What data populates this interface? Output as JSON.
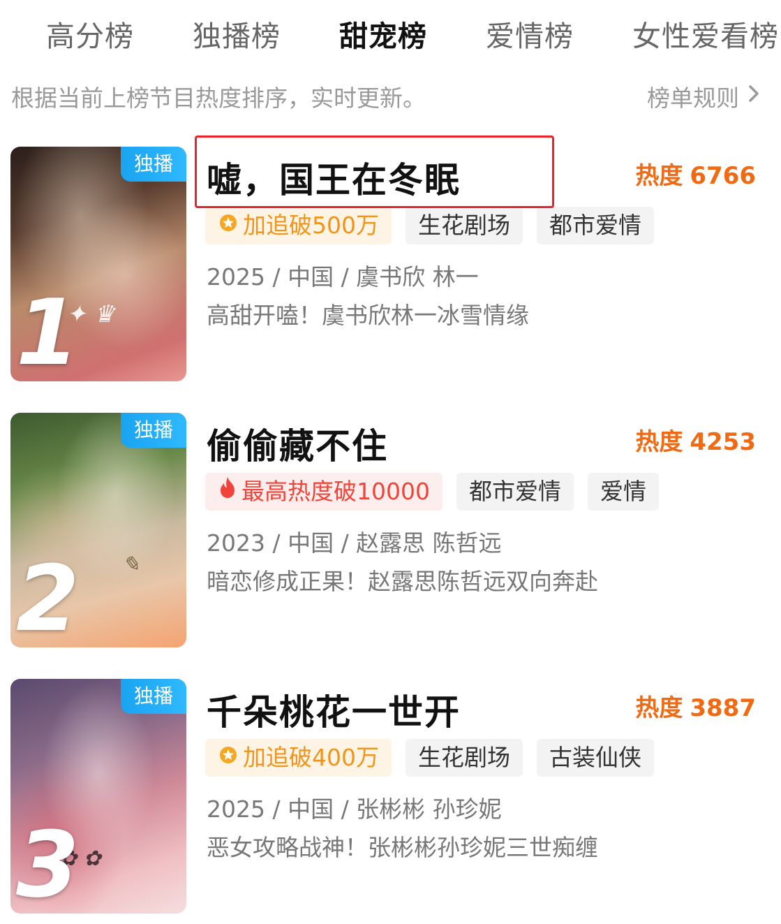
{
  "tabs": [
    "高分榜",
    "独播榜",
    "甜宠榜",
    "爱情榜",
    "女性爱看榜"
  ],
  "active_tab": "甜宠榜",
  "subtitle": "根据当前上榜节目热度排序，实时更新。",
  "rules_label": "榜单规则",
  "heat_label": "热度",
  "exclusive_label": "独播",
  "items": [
    {
      "rank": "1",
      "title": "嘘，国王在冬眠",
      "heat": "6766",
      "badge": {
        "style": "gold",
        "icon": "badge-icon",
        "text": "加追破500万"
      },
      "tags": [
        "生花剧场",
        "都市爱情"
      ],
      "meta": "2025 / 中国 / 虞书欣 林一",
      "desc": "高甜开嗑！虞书欣林一冰雪情缘",
      "poster_colors": [
        "#3a2b25",
        "#a0684a",
        "#e07a6a"
      ]
    },
    {
      "rank": "2",
      "title": "偷偷藏不住",
      "heat": "4253",
      "badge": {
        "style": "red",
        "icon": "fire-icon",
        "text": "最高热度破10000"
      },
      "tags": [
        "都市爱情",
        "爱情"
      ],
      "meta": "2023 / 中国 / 赵露思 陈哲远",
      "desc": "暗恋修成正果！赵露思陈哲远双向奔赴",
      "poster_colors": [
        "#4f6a3a",
        "#c7b79a",
        "#f0a86a"
      ]
    },
    {
      "rank": "3",
      "title": "千朵桃花一世开",
      "heat": "3887",
      "badge": {
        "style": "gold",
        "icon": "badge-icon",
        "text": "加追破400万"
      },
      "tags": [
        "生花剧场",
        "古装仙侠"
      ],
      "meta": "2025 / 中国 / 张彬彬 孙珍妮",
      "desc": "恶女攻略战神！张彬彬孙珍妮三世痴缠",
      "poster_colors": [
        "#6a5a78",
        "#c77a8a",
        "#f2c2c2"
      ]
    }
  ],
  "colors": {
    "accent_heat": "#f06a14",
    "exclusive_badge": "#1aa3f0",
    "highlight_box": "#e8242a"
  }
}
